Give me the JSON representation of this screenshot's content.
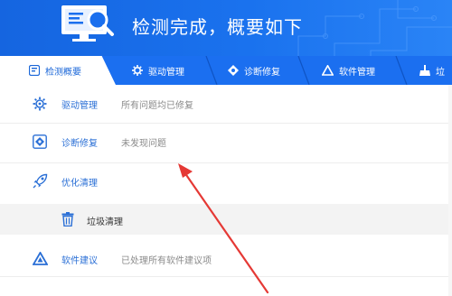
{
  "header": {
    "title": "检测完成，概要如下",
    "logo_icon": "monitor-magnifier-icon",
    "background": "#1a6fee"
  },
  "tabs": [
    {
      "label": "检测概要",
      "icon": "summary-icon",
      "active": true
    },
    {
      "label": "驱动管理",
      "icon": "gear-icon",
      "active": false
    },
    {
      "label": "诊断修复",
      "icon": "repair-icon",
      "active": false
    },
    {
      "label": "软件管理",
      "icon": "software-icon",
      "active": false
    },
    {
      "label": "垃",
      "icon": "broom-icon",
      "active": false
    }
  ],
  "results": [
    {
      "label": "驱动管理",
      "status": "所有问题均已修复",
      "icon": "gear-icon"
    },
    {
      "label": "诊断修复",
      "status": "未发现问题",
      "icon": "repair-icon"
    },
    {
      "label": "优化清理",
      "status": "",
      "icon": "rocket-icon"
    },
    {
      "label": "垃圾清理",
      "status": "",
      "icon": "trash-icon",
      "sub": true
    },
    {
      "label": "软件建议",
      "status": "已处理所有软件建议项",
      "icon": "software-icon"
    }
  ],
  "accent_color": "#2a6fd6",
  "annotation_color": "#e53935"
}
